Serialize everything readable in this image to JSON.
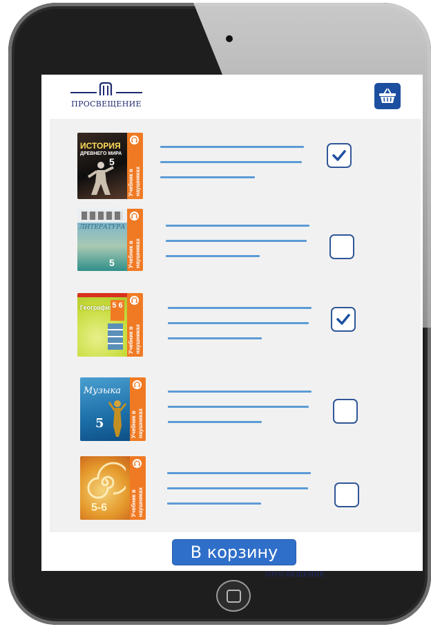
{
  "brand": {
    "logo_text": "ПРОСВЕЩЕНИЕ",
    "bezel_text": "ПРОСВЕЩЕНИЕ",
    "accent_color": "#1d4fa0",
    "line_color": "#5b9bd5"
  },
  "header": {
    "cart_icon": "basket-icon"
  },
  "books": [
    {
      "cover_title": "ИСТОРИЯ",
      "cover_subtitle": "ДРЕВНЕГО МИРА",
      "grade": "5",
      "band_text": "Учебник в наушниках",
      "checked": true
    },
    {
      "cover_title": "ЛИТЕРАТУРА",
      "grade": "5",
      "band_text": "Учебник в наушниках",
      "checked": false
    },
    {
      "cover_title": "География",
      "grade": "5 6",
      "band_text": "Учебник в наушниках",
      "checked": true
    },
    {
      "cover_title": "Музыка",
      "grade": "5",
      "band_text": "Учебник в наушниках",
      "checked": false
    },
    {
      "grade": "5-6",
      "band_text": "Учебник в наушниках",
      "checked": false
    }
  ],
  "footer": {
    "cart_button_label": "В корзину"
  }
}
